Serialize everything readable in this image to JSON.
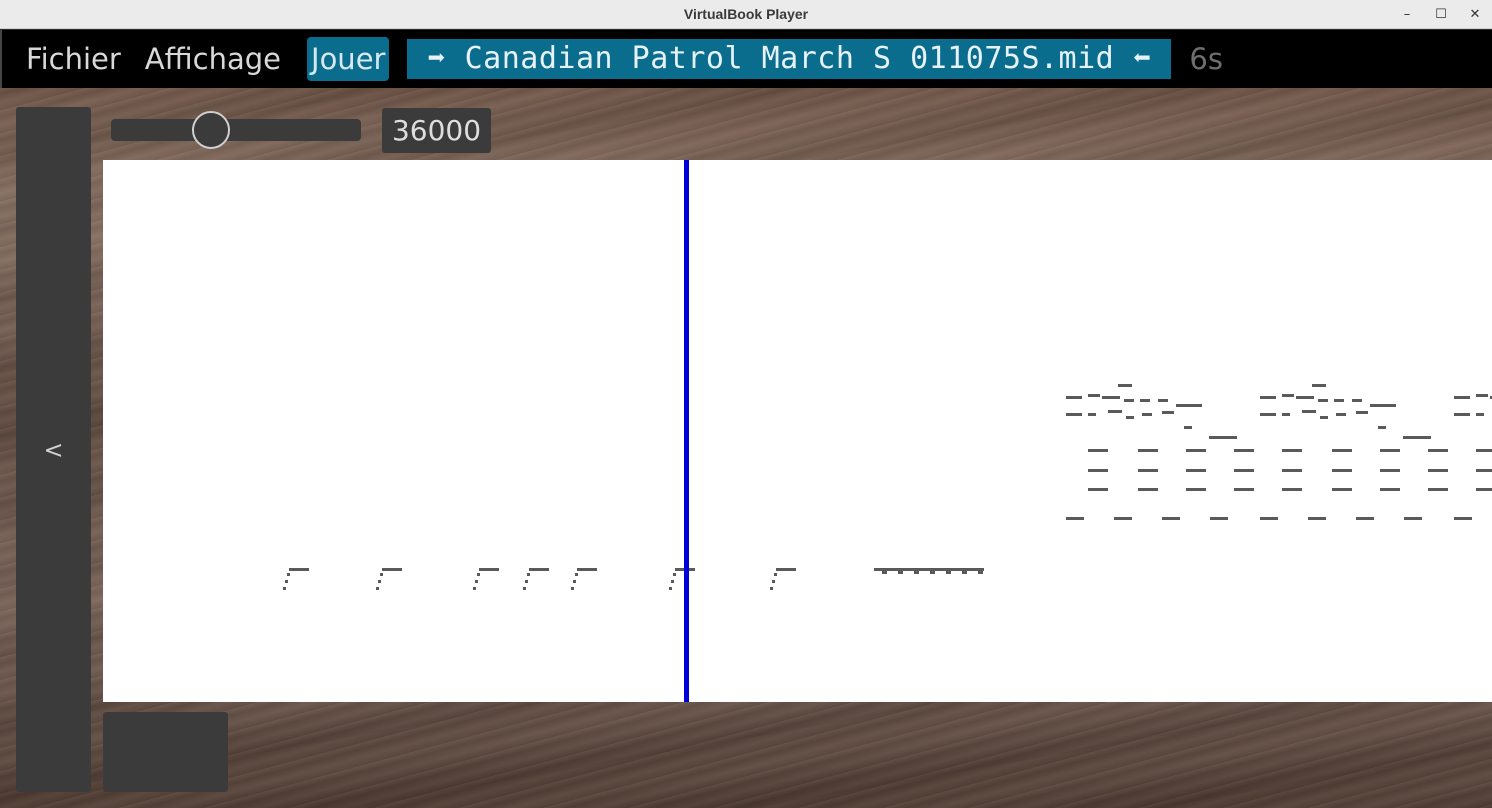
{
  "window": {
    "title": "VirtualBook Player",
    "controls": {
      "minimize": "–",
      "maximize": "☐",
      "close": "✕"
    }
  },
  "menubar": {
    "file": "Fichier",
    "view": "Affichage",
    "play": "Jouer",
    "file_title": "➡ Canadian Patrol March S 011075S.mid ⬅",
    "elapsed": "6s"
  },
  "controls": {
    "left_panel_label": "<",
    "speed_value": "36000",
    "slider_fraction": 0.38
  },
  "colors": {
    "accent": "#0b6d8e",
    "playhead": "#0000dd",
    "note": "#5a5a5a",
    "panel": "#3b3b3b"
  }
}
